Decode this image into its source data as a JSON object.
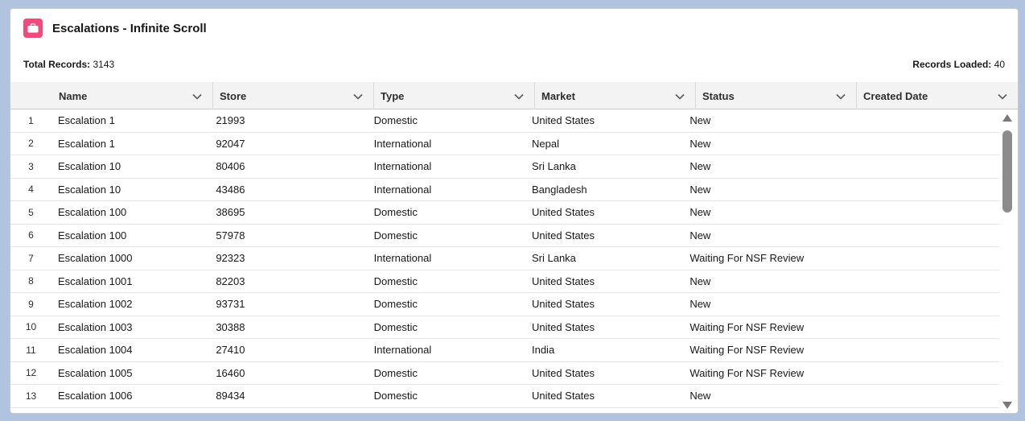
{
  "card": {
    "title": "Escalations - Infinite Scroll",
    "icon": "briefcase-icon",
    "icon_color": "#f4497d"
  },
  "summary": {
    "total_label": "Total Records:",
    "total_value": "3143",
    "loaded_label": "Records Loaded:",
    "loaded_value": "40"
  },
  "columns": [
    "Name",
    "Store",
    "Type",
    "Market",
    "Status",
    "Created Date"
  ],
  "rows": [
    {
      "num": "1",
      "name": "Escalation 1",
      "store": "21993",
      "type": "Domestic",
      "market": "United States",
      "status": "New",
      "created": ""
    },
    {
      "num": "2",
      "name": "Escalation 1",
      "store": "92047",
      "type": "International",
      "market": "Nepal",
      "status": "New",
      "created": ""
    },
    {
      "num": "3",
      "name": "Escalation 10",
      "store": "80406",
      "type": "International",
      "market": "Sri Lanka",
      "status": "New",
      "created": ""
    },
    {
      "num": "4",
      "name": "Escalation 10",
      "store": "43486",
      "type": "International",
      "market": "Bangladesh",
      "status": "New",
      "created": ""
    },
    {
      "num": "5",
      "name": "Escalation 100",
      "store": "38695",
      "type": "Domestic",
      "market": "United States",
      "status": "New",
      "created": ""
    },
    {
      "num": "6",
      "name": "Escalation 100",
      "store": "57978",
      "type": "Domestic",
      "market": "United States",
      "status": "New",
      "created": ""
    },
    {
      "num": "7",
      "name": "Escalation 1000",
      "store": "92323",
      "type": "International",
      "market": "Sri Lanka",
      "status": "Waiting For NSF Review",
      "created": ""
    },
    {
      "num": "8",
      "name": "Escalation 1001",
      "store": "82203",
      "type": "Domestic",
      "market": "United States",
      "status": "New",
      "created": ""
    },
    {
      "num": "9",
      "name": "Escalation 1002",
      "store": "93731",
      "type": "Domestic",
      "market": "United States",
      "status": "New",
      "created": ""
    },
    {
      "num": "10",
      "name": "Escalation 1003",
      "store": "30388",
      "type": "Domestic",
      "market": "United States",
      "status": "Waiting For NSF Review",
      "created": ""
    },
    {
      "num": "11",
      "name": "Escalation 1004",
      "store": "27410",
      "type": "International",
      "market": "India",
      "status": "Waiting For NSF Review",
      "created": ""
    },
    {
      "num": "12",
      "name": "Escalation 1005",
      "store": "16460",
      "type": "Domestic",
      "market": "United States",
      "status": "Waiting For NSF Review",
      "created": ""
    },
    {
      "num": "13",
      "name": "Escalation 1006",
      "store": "89434",
      "type": "Domestic",
      "market": "United States",
      "status": "New",
      "created": ""
    }
  ]
}
